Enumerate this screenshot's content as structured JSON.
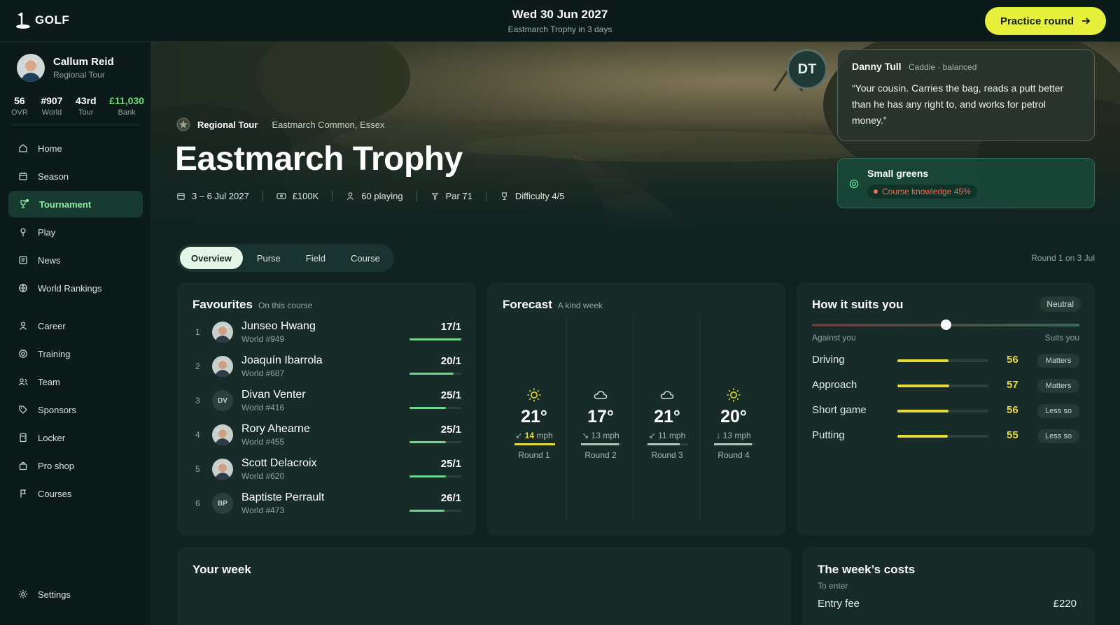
{
  "app": {
    "logo": "GOLF"
  },
  "header": {
    "date": "Wed 30 Jun 2027",
    "subtitle": "Eastmarch Trophy in 3 days",
    "practice_label": "Practice round"
  },
  "profile": {
    "name": "Callum Reid",
    "tour": "Regional Tour",
    "stats": [
      {
        "value": "56",
        "label": "OVR"
      },
      {
        "value": "#907",
        "label": "World"
      },
      {
        "value": "43rd",
        "label": "Tour"
      },
      {
        "value": "£11,030",
        "label": "Bank"
      }
    ]
  },
  "nav": {
    "group1": [
      {
        "label": "Home",
        "icon": "home-icon"
      },
      {
        "label": "Season",
        "icon": "calendar-icon"
      },
      {
        "label": "Tournament",
        "icon": "trophy-icon",
        "active": true
      },
      {
        "label": "Play",
        "icon": "golf-pin-icon"
      },
      {
        "label": "News",
        "icon": "newspaper-icon"
      },
      {
        "label": "World Rankings",
        "icon": "globe-icon"
      }
    ],
    "group2": [
      {
        "label": "Career",
        "icon": "user-icon"
      },
      {
        "label": "Training",
        "icon": "target-icon"
      },
      {
        "label": "Team",
        "icon": "team-icon"
      },
      {
        "label": "Sponsors",
        "icon": "tag-icon"
      },
      {
        "label": "Locker",
        "icon": "locker-icon"
      },
      {
        "label": "Pro shop",
        "icon": "bag-icon"
      },
      {
        "label": "Courses",
        "icon": "flag-icon"
      }
    ],
    "settings": "Settings"
  },
  "tournament": {
    "tour": "Regional Tour",
    "location": "Eastmarch Common, Essex",
    "title": "Eastmarch Trophy",
    "dates": "3 – 6 Jul 2027",
    "purse": "£100K",
    "field": "60 playing",
    "par": "Par 71",
    "difficulty": "Difficulty 4/5"
  },
  "caddie": {
    "initials": "DT",
    "name": "Danny Tull",
    "role": "Caddie · balanced",
    "quote": "“Your cousin. Carries the bag, reads a putt better than he has any right to, and works for petrol money.”"
  },
  "course_note": {
    "title": "Small greens",
    "badge": "Course knowledge 45%"
  },
  "tabs": [
    "Overview",
    "Purse",
    "Field",
    "Course"
  ],
  "round_note": "Round 1 on 3 Jul",
  "favourites": {
    "title": "Favourites",
    "subtitle": "On this course",
    "players": [
      {
        "rank": "1",
        "name": "Junseo Hwang",
        "world": "World #949",
        "odds": "17/1",
        "strength": 1.0,
        "initials": ""
      },
      {
        "rank": "2",
        "name": "Joaquín Ibarrola",
        "world": "World #687",
        "odds": "20/1",
        "strength": 0.85,
        "initials": ""
      },
      {
        "rank": "3",
        "name": "Divan Venter",
        "world": "World #416",
        "odds": "25/1",
        "strength": 0.7,
        "initials": "DV"
      },
      {
        "rank": "4",
        "name": "Rory Ahearne",
        "world": "World #455",
        "odds": "25/1",
        "strength": 0.7,
        "initials": ""
      },
      {
        "rank": "5",
        "name": "Scott Delacroix",
        "world": "World #620",
        "odds": "25/1",
        "strength": 0.7,
        "initials": ""
      },
      {
        "rank": "6",
        "name": "Baptiste Perrault",
        "world": "World #473",
        "odds": "26/1",
        "strength": 0.67,
        "initials": "BP"
      }
    ]
  },
  "forecast": {
    "title": "Forecast",
    "subtitle": "A kind week",
    "rounds": [
      {
        "label": "Round 1",
        "temp": "21°",
        "wind": "14",
        "unit": "mph",
        "arrow": "↙",
        "icon": "sun-icon",
        "windy": true,
        "wind_level": 1.0
      },
      {
        "label": "Round 2",
        "temp": "17°",
        "wind": "13",
        "unit": "mph",
        "arrow": "↘",
        "icon": "cloud-icon",
        "windy": false,
        "wind_level": 0.93
      },
      {
        "label": "Round 3",
        "temp": "21°",
        "wind": "11",
        "unit": "mph",
        "arrow": "↙",
        "icon": "cloud-icon",
        "windy": false,
        "wind_level": 0.79
      },
      {
        "label": "Round 4",
        "temp": "20°",
        "wind": "13",
        "unit": "mph",
        "arrow": "↓",
        "icon": "sun-icon",
        "windy": false,
        "wind_level": 0.93
      }
    ]
  },
  "suits": {
    "title": "How it suits you",
    "verdict": "Neutral",
    "position": 0.5,
    "left_label": "Against you",
    "right_label": "Suits you",
    "attributes": [
      {
        "name": "Driving",
        "value": "56",
        "tag": "Matters",
        "level": 0.56
      },
      {
        "name": "Approach",
        "value": "57",
        "tag": "Matters",
        "level": 0.57
      },
      {
        "name": "Short game",
        "value": "56",
        "tag": "Less so",
        "level": 0.56
      },
      {
        "name": "Putting",
        "value": "55",
        "tag": "Less so",
        "level": 0.55
      }
    ]
  },
  "your_week": {
    "title": "Your week"
  },
  "costs": {
    "title": "The week’s costs",
    "subtitle": "To enter",
    "rows": [
      {
        "label": "Entry fee",
        "amount": "£220"
      }
    ]
  },
  "colors": {
    "accent": "#e6ef3a",
    "green": "#6fd48e",
    "yellow": "#e6d93a",
    "danger": "#f06a5a"
  }
}
